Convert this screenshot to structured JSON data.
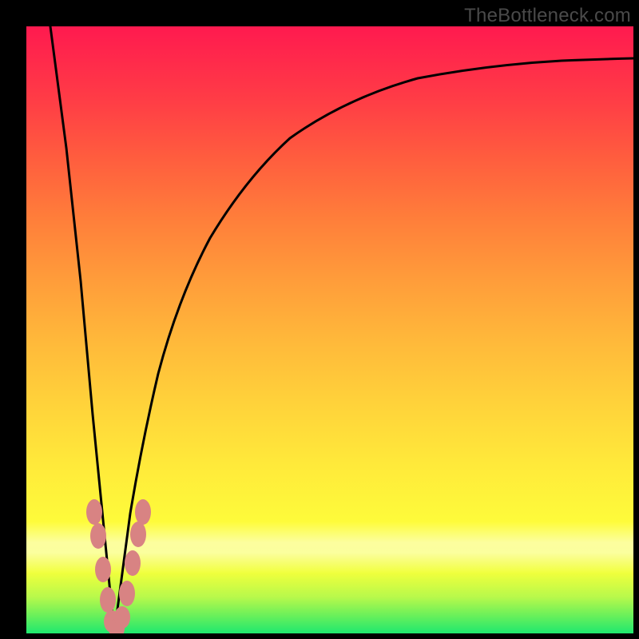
{
  "watermark": "TheBottleneck.com",
  "chart_data": {
    "type": "line",
    "title": "",
    "xlabel": "",
    "ylabel": "",
    "ylim": [
      0,
      100
    ],
    "xlim": [
      0,
      100
    ],
    "curve_left": {
      "name": "left-descent",
      "x": [
        4,
        6,
        8,
        10,
        12,
        14,
        14.5
      ],
      "y": [
        100,
        80,
        58,
        36,
        16,
        3,
        0
      ]
    },
    "curve_right": {
      "name": "right-ascent",
      "x": [
        14.5,
        16,
        18,
        20,
        23,
        27,
        32,
        38,
        45,
        53,
        62,
        72,
        83,
        95,
        100
      ],
      "y": [
        0,
        8,
        20,
        32,
        45,
        58,
        68,
        76,
        82,
        86.5,
        89.5,
        91.5,
        93,
        94,
        94.5
      ]
    },
    "markers": {
      "name": "data-points",
      "color": "#d98080",
      "x": [
        10.5,
        11.5,
        12.5,
        13.5,
        13.8,
        14.7,
        15.5,
        16.3,
        17.0,
        17.8,
        18.5
      ],
      "y": [
        20,
        16,
        10,
        5,
        2,
        1,
        3,
        7,
        12,
        17,
        20
      ]
    },
    "gradient_stops": [
      {
        "pos": 0,
        "color": "#1ee86f"
      },
      {
        "pos": 10,
        "color": "#f0ff3c"
      },
      {
        "pos": 50,
        "color": "#ffb93a"
      },
      {
        "pos": 100,
        "color": "#ff1a4f"
      }
    ]
  }
}
